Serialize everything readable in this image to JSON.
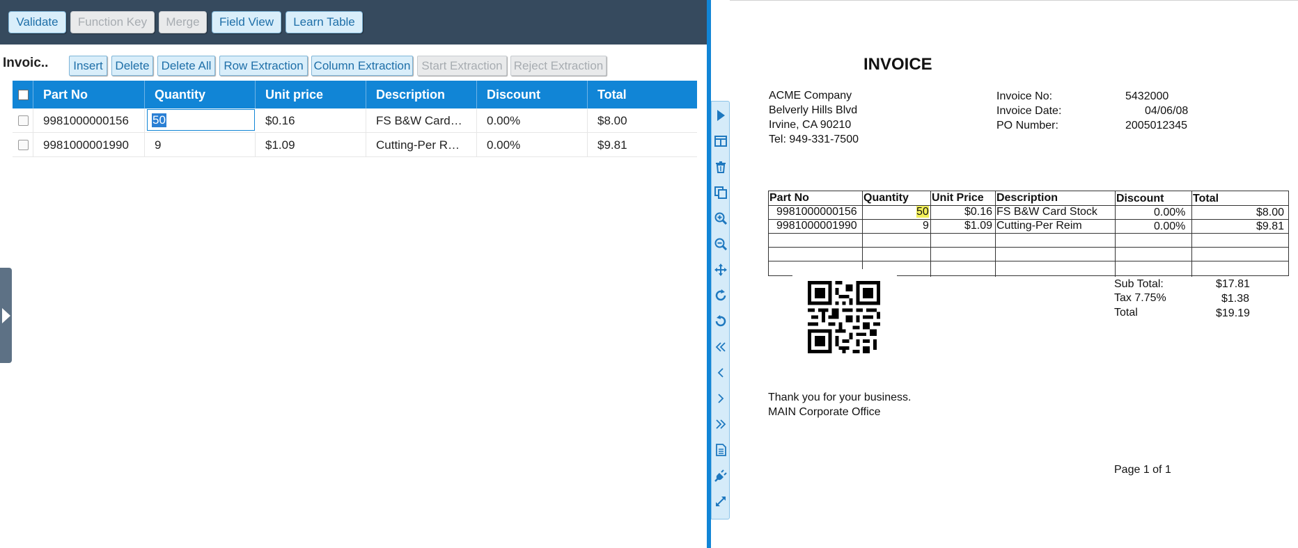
{
  "toolbar": {
    "buttons": [
      {
        "label": "Validate",
        "enabled": true
      },
      {
        "label": "Function Key",
        "enabled": false
      },
      {
        "label": "Merge",
        "enabled": false
      },
      {
        "label": "Field View",
        "enabled": true
      },
      {
        "label": "Learn Table",
        "enabled": true
      }
    ]
  },
  "grid": {
    "title": "Invoic..",
    "buttons": [
      {
        "label": "Insert",
        "enabled": true
      },
      {
        "label": "Delete",
        "enabled": true
      },
      {
        "label": "Delete All",
        "enabled": true
      },
      {
        "label": "Row Extraction",
        "enabled": true
      },
      {
        "label": "Column Extraction",
        "enabled": true
      },
      {
        "label": "Start Extraction",
        "enabled": false
      },
      {
        "label": "Reject Extraction",
        "enabled": false
      }
    ],
    "columns": [
      "Part No",
      "Quantity",
      "Unit price",
      "Description",
      "Discount",
      "Total"
    ],
    "rows": [
      {
        "part_no": "9981000000156",
        "quantity": "50",
        "unit_price": "$0.16",
        "description": "FS B&W Card…",
        "discount": "0.00%",
        "total": "$8.00"
      },
      {
        "part_no": "9981000001990",
        "quantity": "9",
        "unit_price": "$1.09",
        "description": "Cutting-Per R…",
        "discount": "0.00%",
        "total": "$9.81"
      }
    ]
  },
  "viewer_tools": [
    "play-icon",
    "split-view-icon",
    "trash-icon",
    "copy-icon",
    "zoom-in-icon",
    "zoom-out-icon",
    "move-icon",
    "rotate-right-icon",
    "rotate-left-icon",
    "first-page-icon",
    "prev-page-icon",
    "next-page-icon",
    "last-page-icon",
    "document-icon",
    "plug-icon",
    "expand-icon"
  ],
  "document": {
    "title": "INVOICE",
    "company": [
      "ACME Company",
      "Belverly Hills Blvd",
      "Irvine, CA 90210",
      "Tel: 949-331-7500"
    ],
    "meta": [
      {
        "label": "Invoice No:",
        "value": "5432000"
      },
      {
        "label": "Invoice Date:",
        "value": "04/06/08"
      },
      {
        "label": "PO Number:",
        "value": "2005012345"
      }
    ],
    "table": {
      "headers": [
        "Part No",
        "Quantity",
        "Unit Price",
        "Description",
        "Discount",
        "Total"
      ],
      "rows": [
        {
          "part_no": "9981000000156",
          "quantity": "50",
          "unit_price": "$0.16",
          "description": "FS B&W Card Stock",
          "discount": "0.00%",
          "total": "$8.00"
        },
        {
          "part_no": "9981000001990",
          "quantity": "9",
          "unit_price": "$1.09",
          "description": "Cutting-Per Reim",
          "discount": "0.00%",
          "total": "$9.81"
        }
      ]
    },
    "totals": [
      {
        "label": "Sub Total:",
        "value": "$17.81"
      },
      {
        "label": "Tax 7.75%",
        "value": "$1.38"
      },
      {
        "label": "Total",
        "value": "$19.19"
      }
    ],
    "footer": [
      "Thank you for your business.",
      "MAIN Corporate Office"
    ],
    "page": "Page 1 of 1"
  },
  "colors": {
    "accent": "#1185d6",
    "topbar": "#364a5e",
    "highlight": "#f2ef5a"
  }
}
